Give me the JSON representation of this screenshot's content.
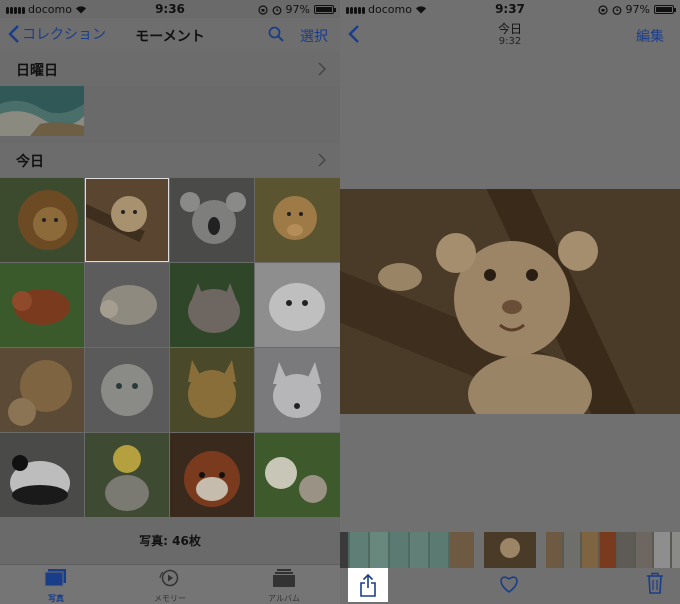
{
  "left": {
    "status": {
      "carrier": "docomo",
      "time": "9:36",
      "battery": "97%",
      "battery_level": 0.97
    },
    "nav": {
      "back_label": "コレクション",
      "title": "モーメント",
      "select_label": "選択"
    },
    "sections": [
      {
        "title": "日曜日"
      },
      {
        "title": "今日"
      }
    ],
    "photo_count": "写真: 46枚",
    "tabs": [
      {
        "label": "写真",
        "icon": "photos-icon",
        "active": true
      },
      {
        "label": "メモリー",
        "icon": "memories-icon",
        "active": false
      },
      {
        "label": "アルバム",
        "icon": "albums-icon",
        "active": false
      }
    ],
    "grid_thumbs": [
      "lion",
      "lion-cub",
      "koala",
      "puppy",
      "red-panda",
      "hedgehog",
      "wolf",
      "seal-pup",
      "lion-and-cub",
      "snow-leopard",
      "serval",
      "arctic-fox",
      "panda",
      "chick-and-kitten",
      "red-panda-face",
      "puppy-and-kitten"
    ]
  },
  "right": {
    "status": {
      "carrier": "docomo",
      "time": "9:37",
      "battery": "97%",
      "battery_level": 0.97
    },
    "nav": {
      "title": "今日",
      "subtitle": "9:32",
      "edit_label": "編集"
    },
    "toolbar": {
      "share_icon": "share-icon",
      "heart_icon": "heart-icon",
      "trash_icon": "trash-icon"
    }
  },
  "colors": {
    "accent": "#1a3d8a",
    "overlay": "#6a6a6a"
  }
}
